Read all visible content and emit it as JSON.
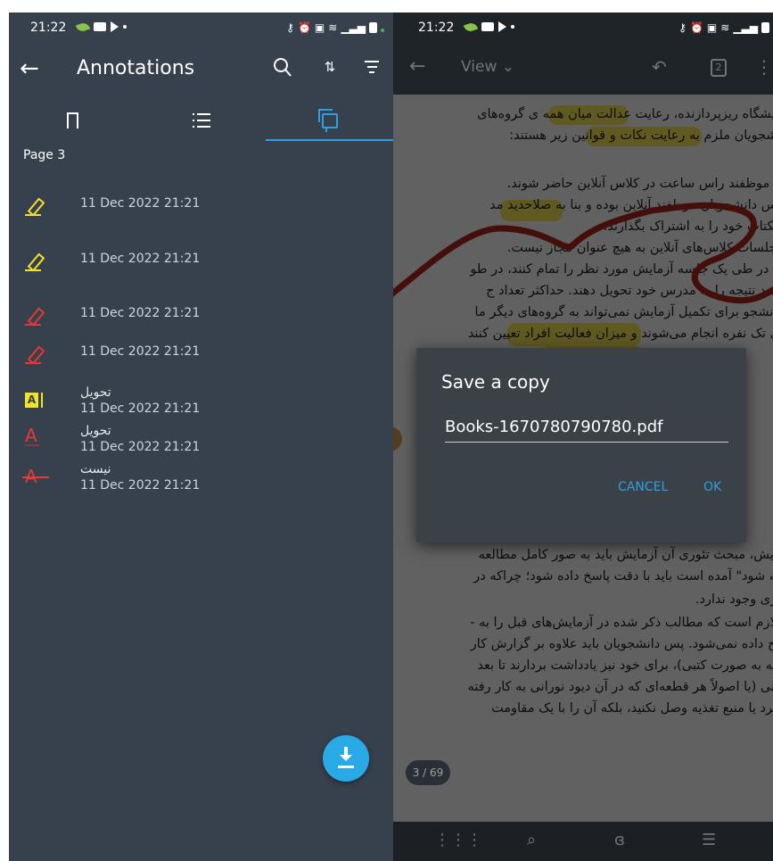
{
  "left": {
    "status": {
      "time": "21:22"
    },
    "appbar": {
      "title": "Annotations"
    },
    "page_header": "Page 3",
    "annotations": [
      {
        "type": "highlight-pencil",
        "color": "#f3e22a",
        "date": "11 Dec 2022 21:21"
      },
      {
        "type": "highlight-pencil",
        "color": "#f3e22a",
        "date": "11 Dec 2022 21:21"
      },
      {
        "type": "freehand-pencil",
        "color": "#e53935",
        "date": "11 Dec 2022 21:21"
      },
      {
        "type": "freehand-pencil",
        "color": "#e53935",
        "date": "11 Dec 2022 21:21"
      },
      {
        "type": "text-highlight",
        "color": "#f3e22a",
        "text": "تحويل",
        "date": "11 Dec 2022 21:21"
      },
      {
        "type": "squiggly-underline",
        "color": "#e53935",
        "text": "تحويل",
        "date": "11 Dec 2022 21:21"
      },
      {
        "type": "strikeout",
        "color": "#e53935",
        "text": "نيست",
        "date": "11 Dec 2022 21:21"
      }
    ],
    "accent": "#2f9fe0"
  },
  "right": {
    "status": {
      "time": "21:22"
    },
    "toolbar": {
      "view_label": "View",
      "page_count_badge": "2"
    },
    "doc_lines": [
      "ــ پیشگاه ریزپردازنده، رعایت عدالت میان همه ی گروه‌های",
      "دانشجویان ملزم به رعایت نکات و قوانین زیر هستند:",
      "یان موظفند راس ساعت در کلاس آنلاین حاضر شوند.",
      "کلاس دانشجویان موظفند آنلاین بوده و بنا به صلاحدید مد",
      "دسکتاپ خود را به اشتراک بگذارند.",
      "از جلسات کلاس‌های آنلاین به هیچ عنوان مجاز نیست.",
      "انند در طی یک جلسه آزمایش مورد نظر را تمام کنند، در طو",
      "به بعد نتیجه را به مدرس خود تحویل دهند. حداکثر تعداد ج",
      ". دانشجو برای تکمیل آزمایش نمی‌تواند به گروه‌های دیگر ما",
      "های تک نفره انجام می‌شوند و میزان فعالیت افراد تعیین کنند",
      "زمایش، مبحث تئوری آن آزمایش باید به صور کامل مطالعه",
      "شته شود\" آمده است باید با دقت پاسخ داده شود؛ چراکه در",
      "تئوری وجود ندارد.",
      "ن لازم است که مطالب ذکر شده در آزمایش‌های قبل را به -",
      "ضیح داده نمی‌شود. پس دانشجویان باید علاوه بر گزارش کار",
      "و چه به صورت کتبی)، برای خود نیز یادداشت بردارند تا بعد",
      "ورانی (یا اصولاً هر قطعه‌ای که در آن دیود نورانی به کار رفته",
      "ی برد یا منبع تغذیه وصل نکنید، بلکه آن را با یک مقاومت"
    ],
    "dialog": {
      "title": "Save a copy",
      "filename": "Books-1670780790780.pdf",
      "cancel": "CANCEL",
      "ok": "OK"
    },
    "page_indicator": "3 / 69"
  }
}
